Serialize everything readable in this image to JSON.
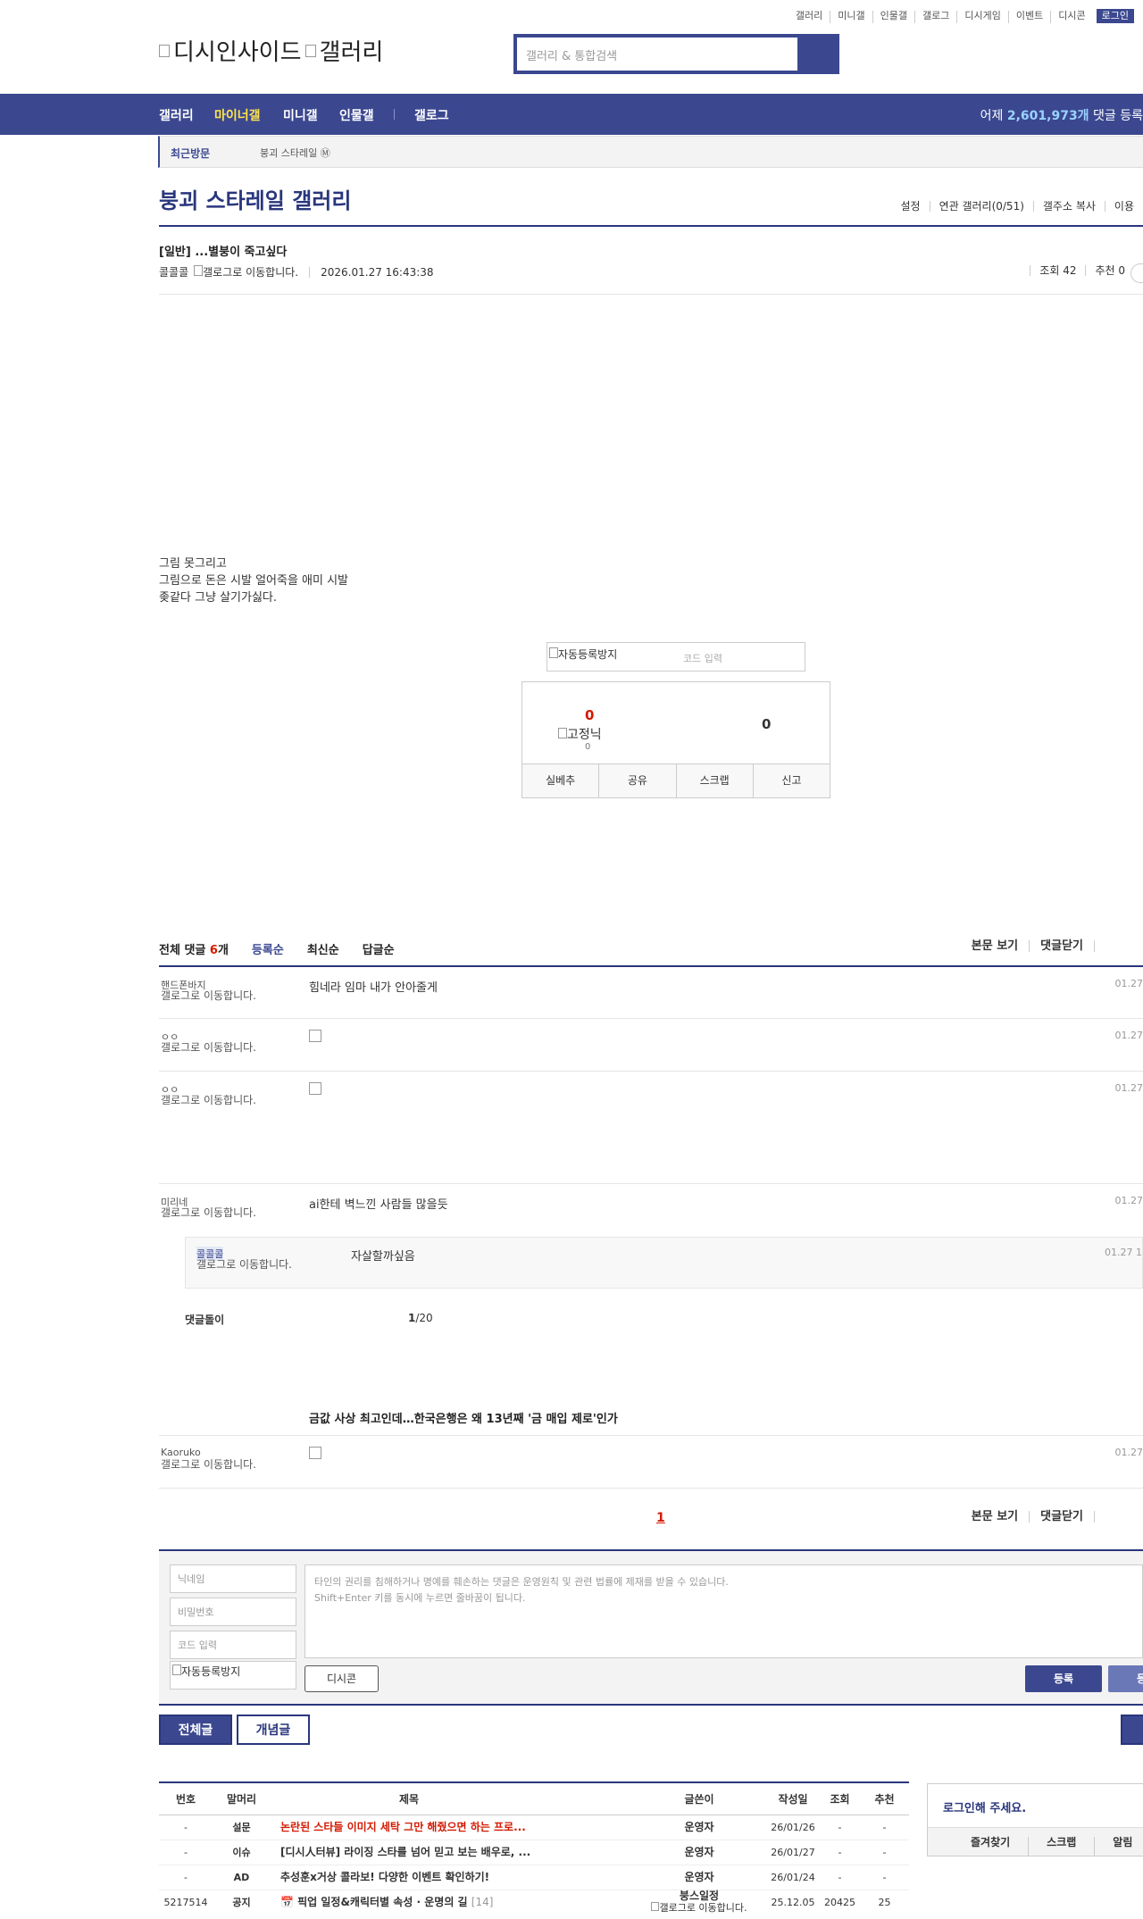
{
  "util_links": [
    "갤러리",
    "미니갤",
    "인물갤",
    "갤로그",
    "디시게임",
    "이벤트",
    "디시콘"
  ],
  "login_label": "로그인",
  "logo_alt": "디시인사이드",
  "logo_alt2": "갤러리",
  "search_placeholder": "갤러리 & 통합검색",
  "gnb": {
    "items": [
      "갤러리",
      "마이너갤",
      "미니갤",
      "인물갤",
      "갤로그"
    ],
    "stat_prefix": "어제 ",
    "stat_count": "2,601,973개",
    "stat_suffix": " 댓글 등록"
  },
  "recent": {
    "title": "최근방문",
    "gallery": "붕괴 스타레일",
    "icon_char": "Ⓜ"
  },
  "gallery_title": "붕괴 스타레일 갤러리",
  "title_links": [
    "설정",
    "연관 갤러리(0/51)",
    "갤주소 복사",
    "이용"
  ],
  "post": {
    "title": "[일반] ...별붕이 죽고싶다",
    "writer": "콜콜콜",
    "gallog_alt": "갤로그로 이동합니다.",
    "date": "2026.01.27 16:43:38",
    "views": "조회 42",
    "recommend": "추천 0",
    "content": [
      "그림 못그리고",
      "그림으로 돈은 시발 얼어죽을 애미 시발",
      "좆같다 그냥 살기가싫다."
    ]
  },
  "captcha": {
    "alt": "자동등록방지",
    "placeholder": "코드 입력"
  },
  "rec_box": {
    "up": "0",
    "fixed_alt": "고정닉",
    "fixed_count": "0",
    "down": "0",
    "buttons": [
      "실베추",
      "공유",
      "스크랩",
      "신고"
    ]
  },
  "comments_head": {
    "total_prefix": "전체 댓글 ",
    "total_count": "6",
    "total_suffix": "개",
    "sorts": [
      "등록순",
      "최신순",
      "답글순"
    ],
    "right": [
      "본문 보기",
      "댓글닫기"
    ]
  },
  "comments": [
    {
      "nick": "핸드폰바지",
      "gal": "갤로그로 이동합니다.",
      "text": "힘네라 임마 내가 안아줄게",
      "date": "01.27"
    },
    {
      "nick": "ㅇㅇ",
      "gal": "갤로그로 이동합니다.",
      "text": "",
      "date": "01.27"
    },
    {
      "nick": "ㅇㅇ",
      "gal": "갤로그로 이동합니다.",
      "text": "",
      "date": "01.27"
    },
    {
      "nick": "미리네",
      "gal": "갤로그로 이동합니다.",
      "text": "ai한테 벽느낀 사람들 많을듯",
      "date": "01.27"
    },
    {
      "nick": "Kaoruko",
      "gal": "갤로그로 이동합니다.",
      "text": "",
      "date": "01.27"
    }
  ],
  "reply": {
    "nick": "콜콜콜",
    "gal": "갤로그로 이동합니다.",
    "text": "자살할까싶음",
    "date": "01.27 1"
  },
  "dolgi": {
    "label": "댓글돌이",
    "page": "1",
    "total": "/20"
  },
  "news_title": "금값 사상 최고인데…한국은행은 왜 13년째 '금 매입 제로'인가",
  "pagination": "1",
  "bottom_links": [
    "본문 보기",
    "댓글닫기"
  ],
  "write": {
    "nick_ph": "닉네임",
    "pw_ph": "비밀번호",
    "code_ph": "코드 입력",
    "captcha_alt": "자동등록방지",
    "notice": [
      "타인의 권리를 침해하거나 명예를 훼손하는 댓글은 운영원칙 및 관련 법률에 제재를 받을 수 있습니다.",
      "Shift+Enter 키를 동시에 누르면 줄바꿈이 됩니다."
    ],
    "dccon": "디시콘",
    "submit": "등록",
    "submit2": "등록"
  },
  "list_buttons": [
    "전체글",
    "개념글"
  ],
  "table": {
    "headers": [
      "번호",
      "말머리",
      "제목",
      "글쓴이",
      "작성일",
      "조회",
      "추천"
    ],
    "rows": [
      {
        "no": "-",
        "head": "설문",
        "subj": "논란된 스타들 이미지 세탁 그만 해줬으면 하는 프로...",
        "writer": "운영자",
        "date": "26/01/26",
        "views": "-",
        "rec": "-",
        "red": true
      },
      {
        "no": "-",
        "head": "이슈",
        "subj": "[디시人터뷰] 라이징 스타를 넘어 믿고 보는 배우로, ...",
        "writer": "운영자",
        "date": "26/01/27",
        "views": "-",
        "rec": "-",
        "red": false
      },
      {
        "no": "-",
        "head": "AD",
        "subj": "추성훈x거상 콜라보! 다양한 이벤트 확인하기!",
        "writer": "운영자",
        "date": "26/01/24",
        "views": "-",
        "rec": "-",
        "red": false
      },
      {
        "no": "5217514",
        "head": "공지",
        "subj": "📅 픽업 일정&캐릭터별 속성 · 운명의 길",
        "reply": "[14]",
        "writer": "붕스일정",
        "writer_alt": "갤로그로 이동합니다.",
        "date": "25.12.05",
        "views": "20425",
        "rec": "25",
        "red": false
      }
    ]
  },
  "login_box": {
    "title": "로그인해 주세요.",
    "links": [
      "즐겨찾기",
      "스크랩",
      "알림"
    ]
  }
}
